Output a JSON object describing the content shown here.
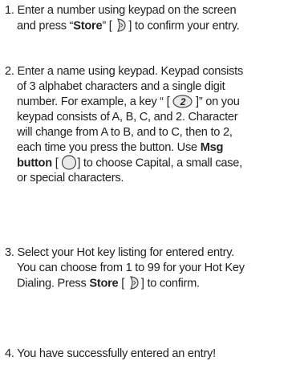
{
  "steps": [
    {
      "number": "1.",
      "lines": {
        "l1": "Enter a number using keypad on the screen",
        "l2_a": "and press “",
        "l2_store": "Store",
        "l2_b": "” [",
        "l2_c": "] to confirm your entry."
      },
      "icon": "store-key-icon"
    },
    {
      "number": "2.",
      "lines": {
        "l1": "Enter a name using keypad.  Keypad consists",
        "l2": "of 3 alphabet characters and a single digit",
        "l3_a": "number.   For example, a key “ [",
        "l3_b": "]” on you",
        "l4": "keypad consists of A, B, C, and 2.   Character",
        "l5": "will change from A to B, and to C, then to 2,",
        "l6_a": "each time you press the button.  Use",
        "l6_msg": "Msg",
        "l7_btn": "button",
        "l7_a": "[",
        "l7_b": "] to choose Capital, a small case,",
        "l8": "or special characters."
      },
      "key_digit": "2",
      "icons": [
        "key-2-icon",
        "msg-button-icon"
      ]
    },
    {
      "number": "3.",
      "lines": {
        "l1": "Select your Hot key listing for entered entry.",
        "l2": "You can choose from 1 to 99 for your Hot Key",
        "l3_a": "Dialing. Press",
        "l3_store": "Store",
        "l3_b": "[",
        "l3_c": "] to confirm."
      },
      "icon": "store-key-icon"
    },
    {
      "number": "4.",
      "lines": {
        "l1": "You have successfully entered an entry!"
      }
    }
  ],
  "colors": {
    "text": "#222222",
    "icon_outline": "#444444",
    "icon_fill": "#e9e9e9"
  }
}
